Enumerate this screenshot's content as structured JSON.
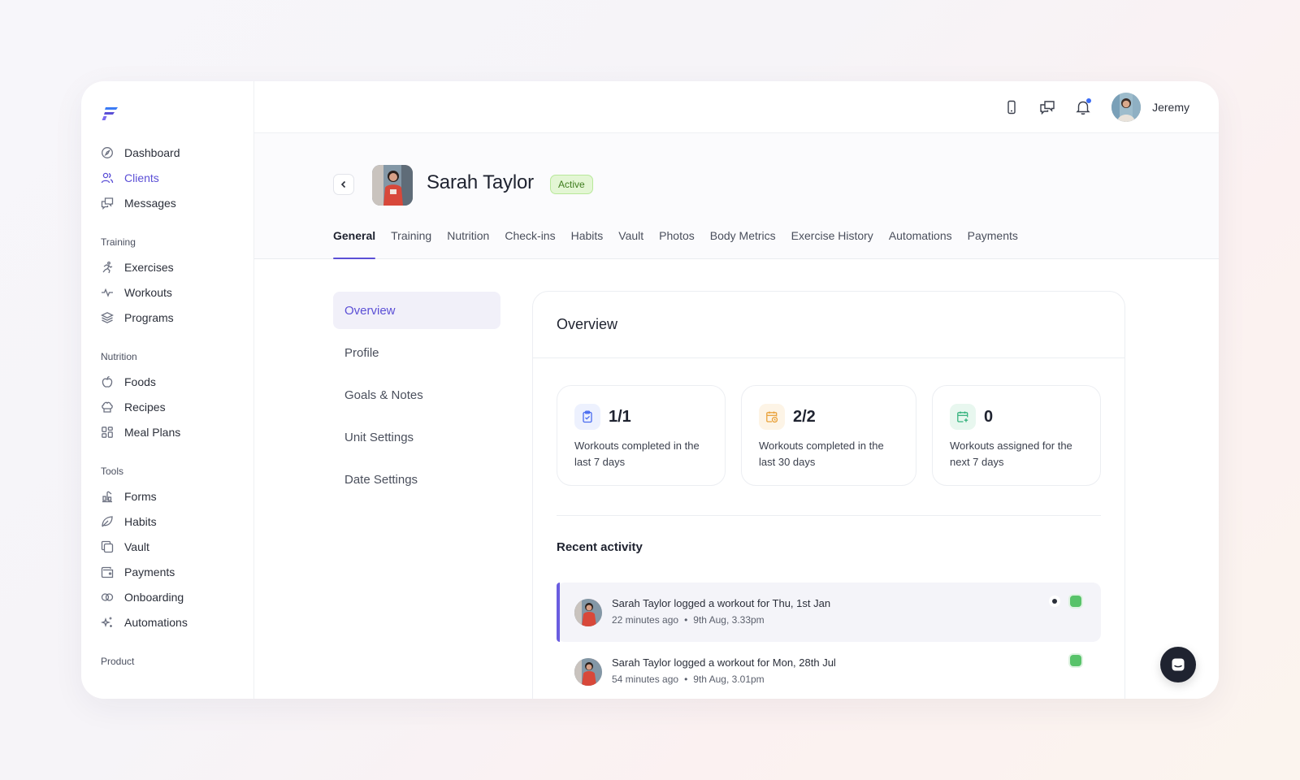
{
  "sidebar": {
    "main_items": [
      {
        "label": "Dashboard",
        "icon": "dashboard-icon"
      },
      {
        "label": "Clients",
        "icon": "users-icon",
        "active": true
      },
      {
        "label": "Messages",
        "icon": "messages-icon"
      }
    ],
    "sections": [
      {
        "label": "Training",
        "items": [
          {
            "label": "Exercises",
            "icon": "running-icon"
          },
          {
            "label": "Workouts",
            "icon": "pulse-icon"
          },
          {
            "label": "Programs",
            "icon": "layers-icon"
          }
        ]
      },
      {
        "label": "Nutrition",
        "items": [
          {
            "label": "Foods",
            "icon": "apple-icon"
          },
          {
            "label": "Recipes",
            "icon": "chef-hat-icon"
          },
          {
            "label": "Meal Plans",
            "icon": "grid-icon"
          }
        ]
      },
      {
        "label": "Tools",
        "items": [
          {
            "label": "Forms",
            "icon": "form-icon"
          },
          {
            "label": "Habits",
            "icon": "leaf-icon"
          },
          {
            "label": "Vault",
            "icon": "copy-icon"
          },
          {
            "label": "Payments",
            "icon": "wallet-icon"
          },
          {
            "label": "Onboarding",
            "icon": "link-icon"
          },
          {
            "label": "Automations",
            "icon": "sparkle-icon"
          }
        ]
      },
      {
        "label": "Product",
        "items": []
      }
    ]
  },
  "topbar": {
    "user_name": "Jeremy",
    "icons": [
      "phone-icon",
      "chat-icon",
      "bell-icon"
    ]
  },
  "client": {
    "name": "Sarah Taylor",
    "status": "Active"
  },
  "tabs": [
    {
      "label": "General",
      "active": true
    },
    {
      "label": "Training"
    },
    {
      "label": "Nutrition"
    },
    {
      "label": "Check-ins"
    },
    {
      "label": "Habits"
    },
    {
      "label": "Vault"
    },
    {
      "label": "Photos"
    },
    {
      "label": "Body Metrics"
    },
    {
      "label": "Exercise History"
    },
    {
      "label": "Automations"
    },
    {
      "label": "Payments"
    }
  ],
  "sub_nav": [
    {
      "label": "Overview",
      "active": true
    },
    {
      "label": "Profile"
    },
    {
      "label": "Goals & Notes"
    },
    {
      "label": "Unit Settings"
    },
    {
      "label": "Date Settings"
    }
  ],
  "overview": {
    "title": "Overview",
    "stats": [
      {
        "value": "1/1",
        "desc": "Workouts completed in the last 7 days",
        "icon": "clipboard-icon",
        "color": "#4a6cf0",
        "bg": "#edf1fe"
      },
      {
        "value": "2/2",
        "desc": "Workouts completed in the last 30 days",
        "icon": "calendar-clock-icon",
        "color": "#e9a23b",
        "bg": "#fdf4e6"
      },
      {
        "value": "0",
        "desc": "Workouts assigned for the next 7 days",
        "icon": "calendar-plus-icon",
        "color": "#36b37e",
        "bg": "#e8f7ef"
      }
    ],
    "recent_title": "Recent activity",
    "activity": [
      {
        "text": "Sarah Taylor logged a workout for Thu, 1st Jan",
        "ago": "22 minutes ago",
        "time": "9th Aug, 3.33pm",
        "unread": true
      },
      {
        "text": "Sarah Taylor logged a workout for Mon, 28th Jul",
        "ago": "54 minutes ago",
        "time": "9th Aug, 3.01pm",
        "unread": false
      }
    ]
  },
  "colors": {
    "accent": "#5b4fd6",
    "active_badge_bg": "#e3f6d4",
    "active_badge_text": "#3f7d1e"
  }
}
